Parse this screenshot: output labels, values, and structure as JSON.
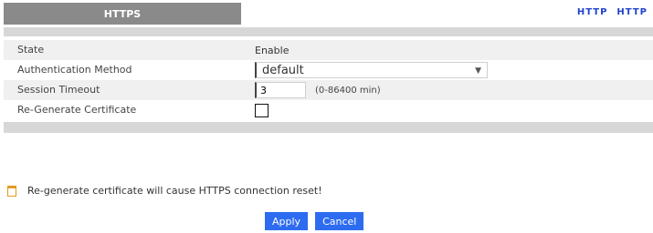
{
  "tabs": {
    "active": "HTTPS",
    "links": [
      "HTTP",
      "HTTP"
    ]
  },
  "form": {
    "state": {
      "label": "State",
      "value": "Enable"
    },
    "auth_method": {
      "label": "Authentication Method",
      "value": "default"
    },
    "session_timeout": {
      "label": "Session Timeout",
      "value": "3",
      "hint": "(0-86400 min)"
    },
    "regen_cert": {
      "label": "Re-Generate Certificate",
      "checked": false
    }
  },
  "note": {
    "text": "Re-generate certificate will cause HTTPS connection reset!"
  },
  "buttons": {
    "apply": "Apply",
    "cancel": "Cancel"
  },
  "colors": {
    "accent": "#2d6cf0",
    "note_icon": "#e39a1e",
    "tab_bg": "#8a8a8a"
  }
}
